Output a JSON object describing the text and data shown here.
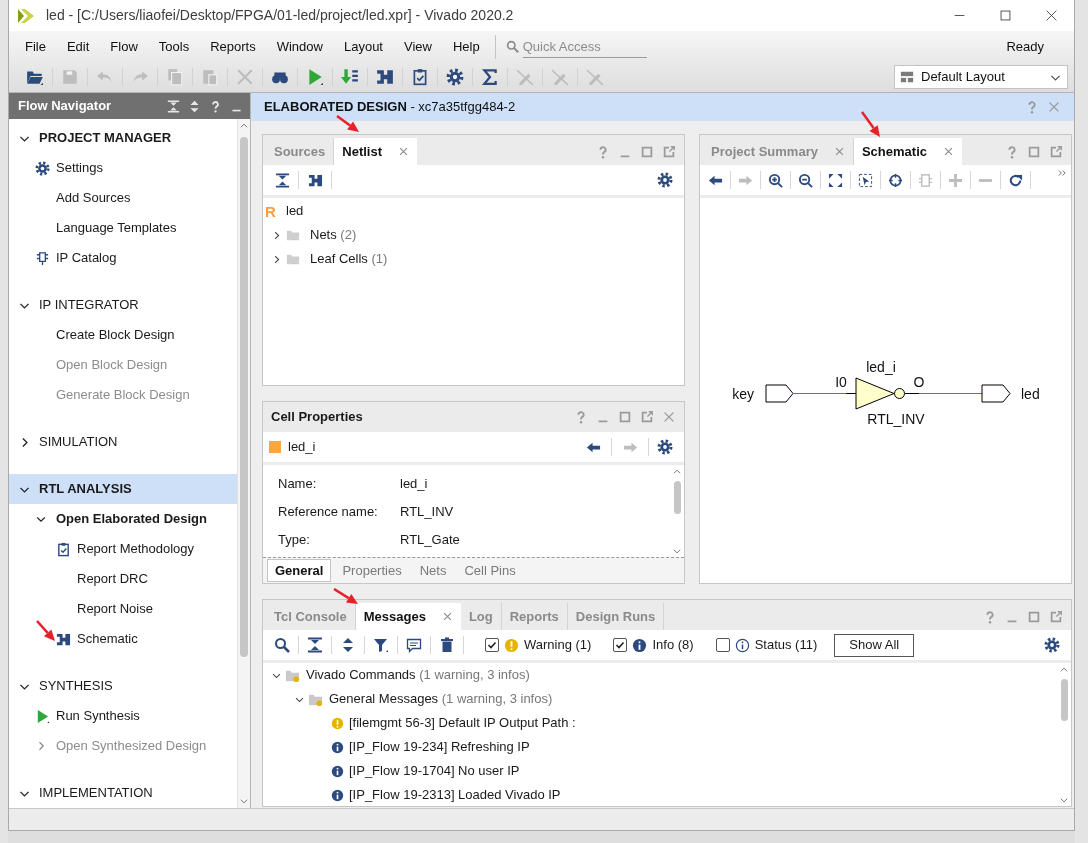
{
  "window": {
    "title": "led - [C:/Users/liaofei/Desktop/FPGA/01-led/project/led.xpr] - Vivado 2020.2"
  },
  "menu": [
    "File",
    "Edit",
    "Flow",
    "Tools",
    "Reports",
    "Window",
    "Layout",
    "View",
    "Help"
  ],
  "quick_access": {
    "placeholder": "Quick Access"
  },
  "status": "Ready",
  "toolbar": [
    {
      "kind": "open",
      "disabled": false
    },
    {
      "kind": "save",
      "disabled": true
    },
    {
      "kind": "undo",
      "disabled": true
    },
    {
      "kind": "redo",
      "disabled": true
    },
    {
      "kind": "copy",
      "disabled": true
    },
    {
      "kind": "paste",
      "disabled": true
    },
    {
      "kind": "delete",
      "disabled": true
    },
    {
      "kind": "find",
      "disabled": false
    },
    {
      "kind": "run",
      "disabled": false
    },
    {
      "kind": "bitstream",
      "disabled": false
    },
    {
      "kind": "schematic",
      "disabled": false
    },
    {
      "kind": "report",
      "disabled": false
    },
    {
      "kind": "settings",
      "disabled": false
    },
    {
      "kind": "sigma",
      "disabled": false
    },
    {
      "kind": "pen",
      "disabled": true
    },
    {
      "kind": "pen",
      "disabled": true
    },
    {
      "kind": "pen",
      "disabled": true
    }
  ],
  "layout_select": {
    "value": "Default Layout"
  },
  "flow_navigator": {
    "title": "Flow Navigator",
    "sections": [
      {
        "label": "PROJECT MANAGER",
        "expanded": true,
        "selected": false,
        "active": true,
        "items": [
          {
            "label": "Settings",
            "kind": "gear",
            "disabled": false
          },
          {
            "label": "Add Sources",
            "disabled": false
          },
          {
            "label": "Language Templates",
            "disabled": false
          },
          {
            "label": "IP Catalog",
            "kind": "ip",
            "disabled": false
          }
        ]
      },
      {
        "label": "IP INTEGRATOR",
        "expanded": true,
        "selected": false,
        "active": false,
        "items": [
          {
            "label": "Create Block Design",
            "disabled": false
          },
          {
            "label": "Open Block Design",
            "disabled": true
          },
          {
            "label": "Generate Block Design",
            "disabled": true
          }
        ]
      },
      {
        "label": "SIMULATION",
        "expanded": false,
        "selected": false,
        "active": false
      },
      {
        "label": "RTL ANALYSIS",
        "expanded": true,
        "selected": true,
        "active": true,
        "items": [
          {
            "label": "Open Elaborated Design",
            "disabled": false,
            "expanded": true,
            "active": true,
            "children": [
              {
                "label": "Report Methodology",
                "kind": "report",
                "disabled": false
              },
              {
                "label": "Report DRC",
                "disabled": false
              },
              {
                "label": "Report Noise",
                "disabled": false
              },
              {
                "label": "Schematic",
                "kind": "schematic",
                "disabled": false
              }
            ]
          }
        ]
      },
      {
        "label": "SYNTHESIS",
        "expanded": true,
        "selected": false,
        "active": false,
        "items": [
          {
            "label": "Run Synthesis",
            "kind": "run",
            "disabled": false
          },
          {
            "label": "Open Synthesized Design",
            "disabled": true,
            "expanded": false,
            "active": false
          }
        ]
      },
      {
        "label": "IMPLEMENTATION",
        "expanded": true,
        "selected": false,
        "active": false
      }
    ]
  },
  "design_header": {
    "title": "**ELABORATED DESIGN** - xc7a35tfgg484-2"
  },
  "netlist_panel": {
    "tabs": [
      {
        "label": "Sources",
        "selected": false,
        "closable": false
      },
      {
        "label": "Netlist",
        "selected": true,
        "closable": true
      }
    ],
    "tree": {
      "badge": "R",
      "label": "led",
      "children": [
        {
          "label": "Nets",
          "count": "(2)",
          "expanded": false
        },
        {
          "label": "Leaf Cells",
          "count": "(1)",
          "expanded": false
        }
      ]
    }
  },
  "cell_properties": {
    "title": "Cell Properties",
    "cell": "led_i",
    "nav": [
      {
        "kind": "back",
        "disabled": false
      },
      {
        "kind": "forward",
        "disabled": true
      }
    ],
    "properties": [
      {
        "name": "Name:",
        "value": "led_i"
      },
      {
        "name": "Reference name:",
        "value": "RTL_INV"
      },
      {
        "name": "Type:",
        "value": "RTL_Gate"
      }
    ],
    "tabs": [
      {
        "label": "General",
        "selected": true
      },
      {
        "label": "Properties",
        "selected": false
      },
      {
        "label": "Nets",
        "selected": false
      },
      {
        "label": "Cell Pins",
        "selected": false
      }
    ]
  },
  "schematic_panel": {
    "tabs": [
      {
        "label": "Project Summary",
        "selected": false,
        "closable": true
      },
      {
        "label": "Schematic",
        "selected": true,
        "closable": true
      }
    ],
    "toolbar": [
      {
        "kind": "back",
        "disabled": false
      },
      {
        "kind": "forward",
        "disabled": true
      },
      {
        "kind": "zoomin",
        "disabled": false
      },
      {
        "kind": "zoomout",
        "disabled": false
      },
      {
        "kind": "fit",
        "disabled": false
      },
      {
        "kind": "zoomsel",
        "disabled": false
      },
      {
        "kind": "target",
        "disabled": false
      },
      {
        "kind": "cell",
        "disabled": true
      },
      {
        "kind": "plus",
        "disabled": true
      },
      {
        "kind": "minus",
        "disabled": true
      },
      {
        "kind": "refresh",
        "disabled": false
      }
    ],
    "ports": [
      {
        "name": "key"
      },
      {
        "name": "led"
      }
    ],
    "cell": {
      "name": "led_i",
      "type": "RTL_INV",
      "input_pin": "I0",
      "output_pin": "O"
    }
  },
  "messages_panel": {
    "tabs": [
      {
        "label": "Tcl Console",
        "selected": false,
        "closable": false
      },
      {
        "label": "Messages",
        "selected": true,
        "closable": true
      },
      {
        "label": "Log",
        "selected": false,
        "closable": false
      },
      {
        "label": "Reports",
        "selected": false,
        "closable": false
      },
      {
        "label": "Design Runs",
        "selected": false,
        "closable": false
      }
    ],
    "filters": [
      {
        "label": "Warning (1)",
        "kind": "warning",
        "checked": true
      },
      {
        "label": "Info (8)",
        "kind": "info",
        "checked": true
      },
      {
        "label": "Status (11)",
        "kind": "status",
        "checked": false
      }
    ],
    "show_all": "Show All",
    "tree": {
      "label": "Vivado Commands",
      "count": "(1 warning, 3 infos)",
      "expanded": true,
      "children": [
        {
          "label": "General Messages",
          "count": "(1 warning, 3 infos)",
          "expanded": true,
          "messages": [
            {
              "kind": "warning",
              "text": "[filemgmt 56-3] Default IP Output Path :"
            },
            {
              "kind": "info",
              "text": "[IP_Flow 19-234] Refreshing IP"
            },
            {
              "kind": "info",
              "text": "[IP_Flow 19-1704] No user IP"
            },
            {
              "kind": "info",
              "text": "[IP_Flow 19-2313] Loaded Vivado IP"
            }
          ]
        }
      ]
    }
  }
}
